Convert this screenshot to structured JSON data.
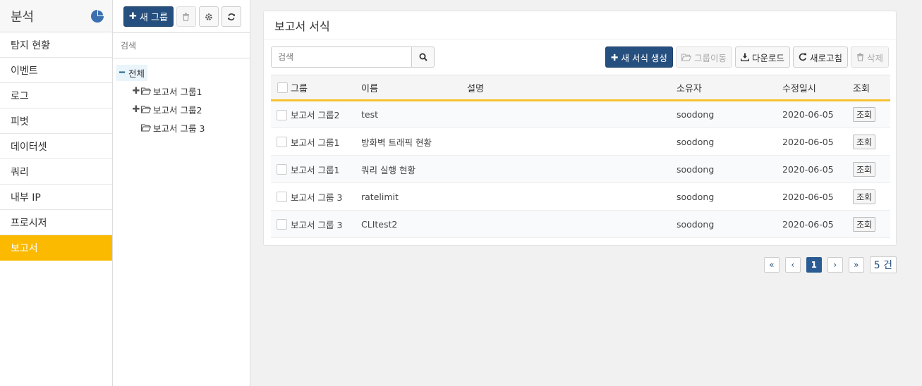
{
  "sidebar": {
    "title": "분석",
    "icon": "pie-chart-icon",
    "items": [
      {
        "label": "탐지 현황"
      },
      {
        "label": "이벤트"
      },
      {
        "label": "로그"
      },
      {
        "label": "피벗"
      },
      {
        "label": "데이터셋"
      },
      {
        "label": "쿼리"
      },
      {
        "label": "내부 IP"
      },
      {
        "label": "프로시저"
      },
      {
        "label": "보고서",
        "active": true
      }
    ]
  },
  "groups": {
    "new_group_label": "새 그룹",
    "search_placeholder": "검색",
    "tree": {
      "root": "전체",
      "children": [
        {
          "label": "보고서 그룹1",
          "expandable": true
        },
        {
          "label": "보고서 그룹2",
          "expandable": true
        },
        {
          "label": "보고서 그룹 3",
          "expandable": false
        }
      ]
    }
  },
  "main": {
    "title": "보고서 서식",
    "search_placeholder": "검색",
    "actions": {
      "create": "새 서식 생성",
      "move": "그룹이동",
      "download": "다운로드",
      "refresh": "새로고침",
      "delete": "삭제"
    },
    "table": {
      "columns": {
        "group": "그룹",
        "name": "이름",
        "desc": "설명",
        "owner": "소유자",
        "modified": "수정일시",
        "view": "조회"
      },
      "rows": [
        {
          "group": "보고서 그룹2",
          "name": "test",
          "desc": "",
          "owner": "soodong",
          "modified": "2020-06-05",
          "view": "조회"
        },
        {
          "group": "보고서 그룹1",
          "name": "방화벽 트래픽 현황",
          "desc": "",
          "owner": "soodong",
          "modified": "2020-06-05",
          "view": "조회"
        },
        {
          "group": "보고서 그룹1",
          "name": "쿼리 실행 현황",
          "desc": "",
          "owner": "soodong",
          "modified": "2020-06-05",
          "view": "조회"
        },
        {
          "group": "보고서 그룹 3",
          "name": "ratelimit",
          "desc": "",
          "owner": "soodong",
          "modified": "2020-06-05",
          "view": "조회"
        },
        {
          "group": "보고서 그룹 3",
          "name": "CLItest2",
          "desc": "",
          "owner": "soodong",
          "modified": "2020-06-05",
          "view": "조회"
        }
      ]
    },
    "pagination": {
      "first": "«",
      "prev": "‹",
      "current": "1",
      "next": "›",
      "last": "»",
      "count": "5 건"
    }
  },
  "colors": {
    "accent": "#fbb900",
    "primary": "#254f7e",
    "table_header_border": "#f6c230"
  }
}
